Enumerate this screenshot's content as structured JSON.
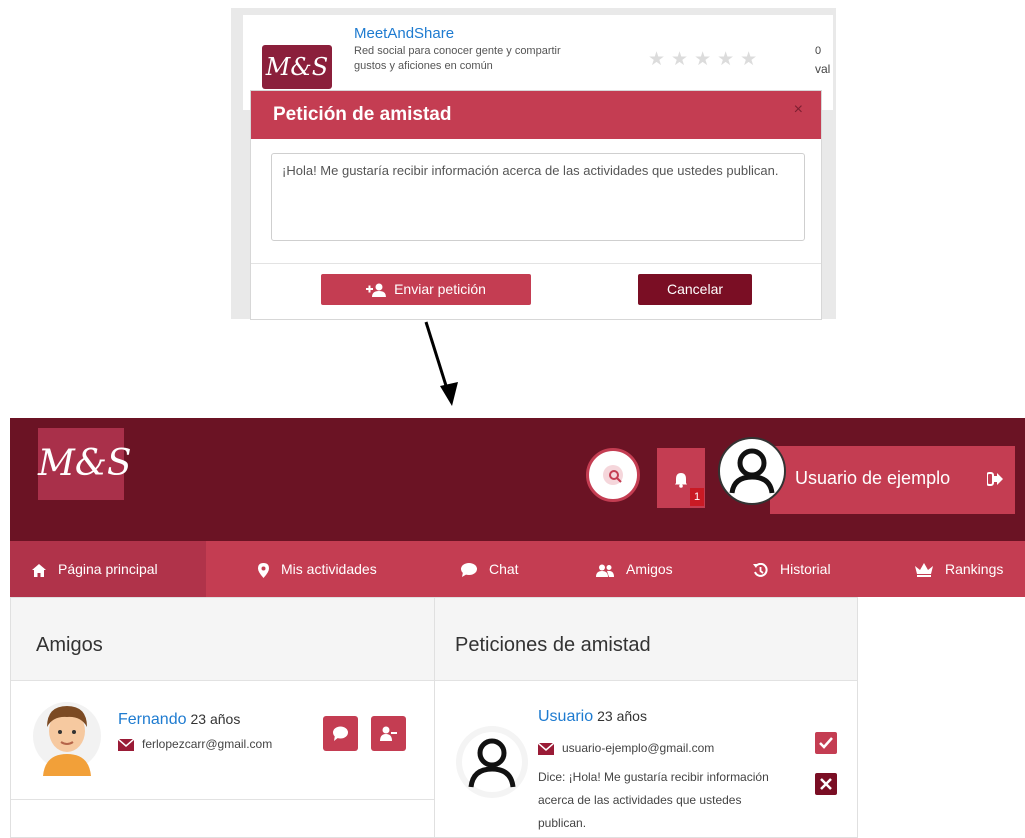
{
  "modal_snippet": {
    "app": {
      "logo_text": "M&S",
      "name": "MeetAndShare",
      "description": "Red social para conocer gente y compartir gustos y aficiones en común",
      "rating_count": "0",
      "rating_unit": "val",
      "stars": "★★★★★"
    },
    "dialog": {
      "title": "Petición de amistad",
      "close_label": "×",
      "message": "¡Hola! Me gustaría recibir información acerca de las actividades que ustedes publican.",
      "send_label": "Enviar petición",
      "cancel_label": "Cancelar"
    }
  },
  "header": {
    "logo_text": "M&S",
    "notifications_count": "1",
    "user_name": "Usuario de ejemplo"
  },
  "menu": {
    "items": [
      {
        "label": "Página principal"
      },
      {
        "label": "Mis actividades"
      },
      {
        "label": "Chat"
      },
      {
        "label": "Amigos"
      },
      {
        "label": "Historial"
      },
      {
        "label": "Rankings"
      }
    ]
  },
  "friends_panel": {
    "title": "Amigos",
    "friends": [
      {
        "name": "Fernando",
        "age": "23 años",
        "email": "ferlopezcarr@gmail.com"
      }
    ]
  },
  "requests_panel": {
    "title": "Peticiones de amistad",
    "requests": [
      {
        "name": "Usuario",
        "age": "23 años",
        "email": "usuario-ejemplo@gmail.com",
        "message_line1": "Dice: ¡Hola! Me gustaría recibir información",
        "message_line2": "acerca de las actividades que ustedes",
        "message_line3": "publican."
      }
    ]
  },
  "colors": {
    "primary": "#c43d52",
    "dark": "#6b1324",
    "accent_dark": "#7a0e24",
    "link": "#1e7bd0"
  }
}
